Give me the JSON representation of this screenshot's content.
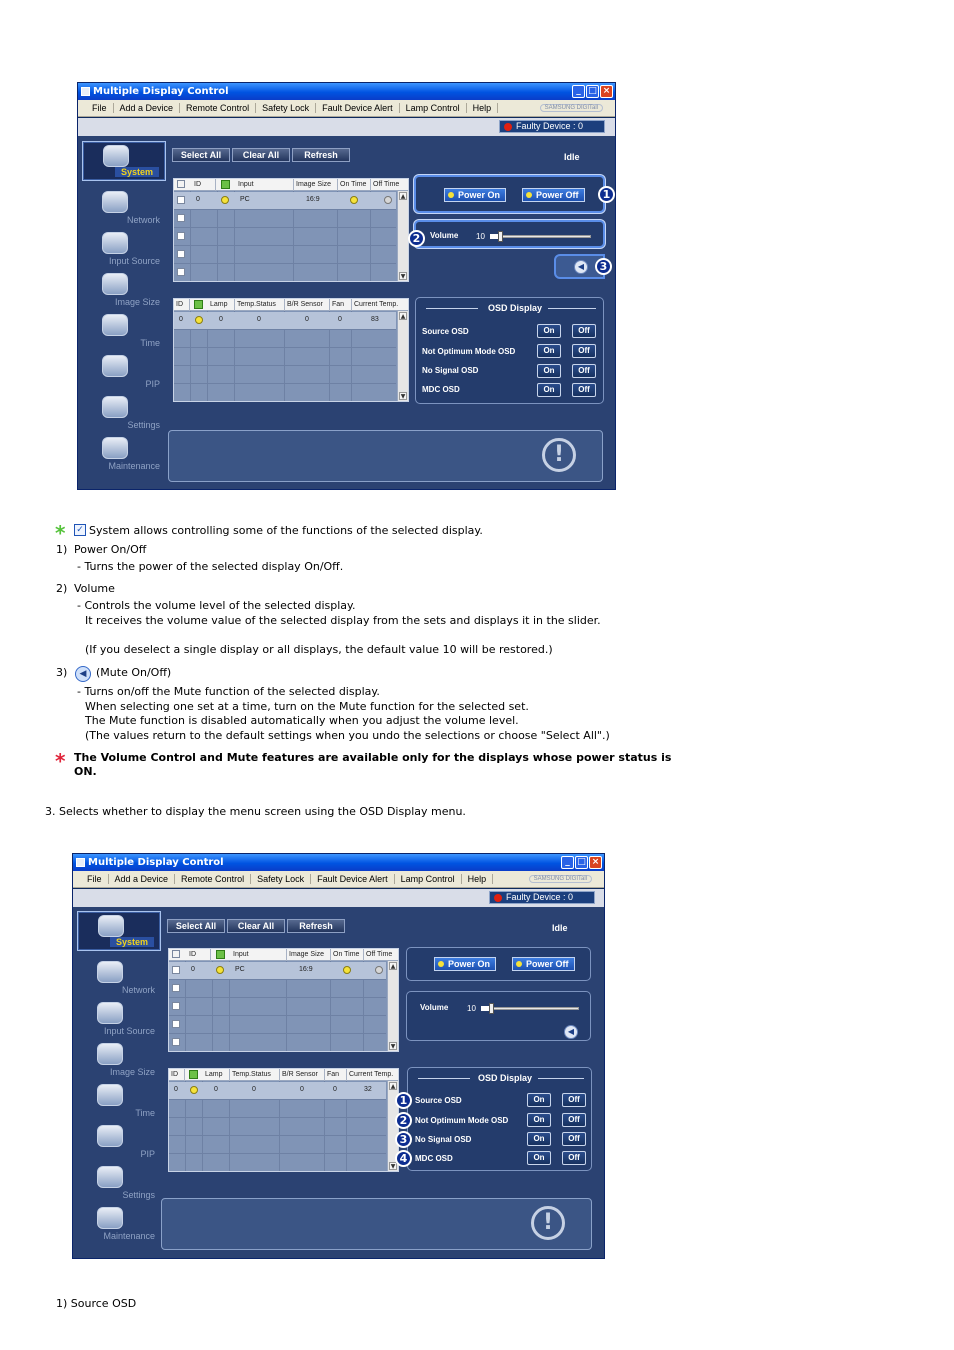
{
  "window": {
    "title": "Multiple Display Control",
    "menu": [
      "File",
      "Add a Device",
      "Remote Control",
      "Safety Lock",
      "Fault Device Alert",
      "Lamp Control",
      "Help"
    ],
    "brand": "SAMSUNG DIGITall",
    "faulty_device": "Faulty Device : 0",
    "toolbar": {
      "select_all": "Select All",
      "clear_all": "Clear All",
      "refresh": "Refresh"
    },
    "status": "Idle",
    "sidebar": [
      "System",
      "Network",
      "Input Source",
      "Image Size",
      "Time",
      "PIP",
      "Settings",
      "Maintenance"
    ],
    "grid_top": {
      "headers": [
        "ID",
        "Input",
        "Image Size",
        "On Time",
        "Off Time"
      ],
      "row": {
        "id": "0",
        "input": "PC",
        "image_size": "16:9"
      }
    },
    "grid_bottom": {
      "headers": [
        "ID",
        "Lamp",
        "Temp.Status",
        "B/R Sensor",
        "Fan",
        "Current Temp."
      ],
      "row": {
        "id": "0",
        "lamp": "0",
        "temp_status": "0",
        "br_sensor": "0",
        "fan": "0"
      }
    },
    "power_on": "Power On",
    "power_off": "Power Off",
    "volume_label": "Volume",
    "volume_value": "10",
    "volume_level": 10,
    "osd": {
      "title": "OSD Display",
      "items": [
        "Source OSD",
        "Not Optimum Mode OSD",
        "No Signal OSD",
        "MDC OSD"
      ],
      "on": "On",
      "off": "Off"
    }
  },
  "screenshot1": {
    "current_temp": "83",
    "badges": [
      "1",
      "2",
      "3"
    ]
  },
  "screenshot2": {
    "current_temp": "32",
    "badges": [
      "1",
      "2",
      "3",
      "4"
    ]
  },
  "manual": {
    "intro": "System allows controlling some of the functions of the selected display.",
    "items": [
      {
        "num": "1)",
        "title": "Power On/Off",
        "lines": [
          "- Turns the power of the selected display On/Off."
        ]
      },
      {
        "num": "2)",
        "title": "Volume",
        "lines": [
          "- Controls the volume level of the selected display.",
          "It receives the volume value of the selected display from the sets and displays it in the slider.",
          "(If you deselect a single display or all displays, the default value 10 will be restored.)"
        ]
      },
      {
        "num": "3)",
        "title": "(Mute On/Off)",
        "lines": [
          "- Turns on/off the Mute function of the selected display.",
          "When selecting one set at a time, turn on the Mute function for the selected set.",
          "The Mute function is disabled automatically when you adjust the volume level.",
          "(The values return to the default settings when you undo the selections or choose \"Select All\".)"
        ]
      }
    ],
    "note_line1": "The Volume Control and Mute features are available only for the displays whose power status is",
    "note_line2": "ON.",
    "osd_intro": "3. Selects whether to display the menu screen using the OSD Display menu.",
    "final": "1) Source OSD"
  }
}
